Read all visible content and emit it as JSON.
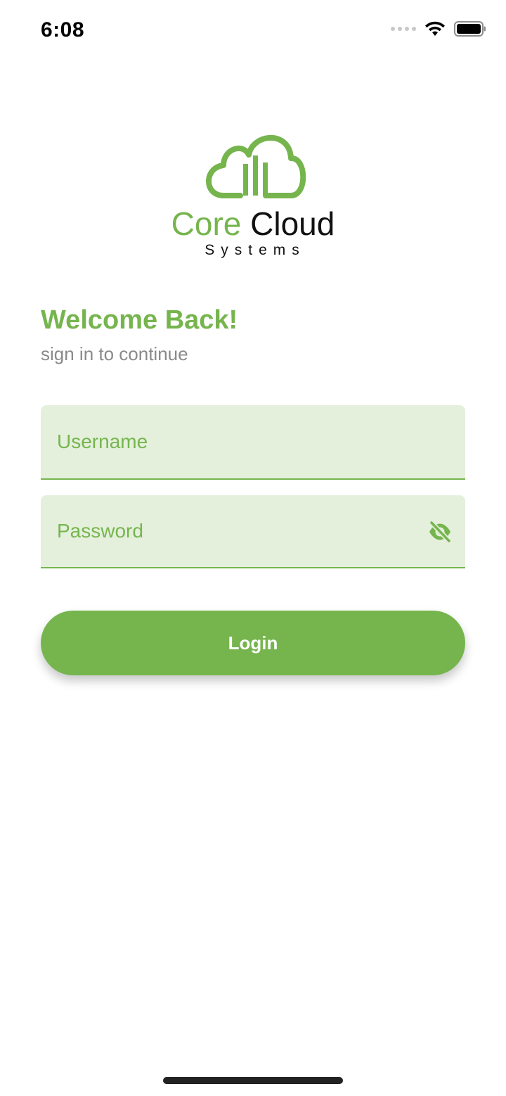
{
  "status_bar": {
    "time": "6:08",
    "icons": [
      "cellular-signal-icon",
      "wifi-icon",
      "battery-icon"
    ]
  },
  "logo": {
    "word1": "Core",
    "word2": "Cloud",
    "subtitle": "Systems",
    "icon": "cloud-buildings-icon"
  },
  "welcome": {
    "title": "Welcome Back!",
    "subtitle": "sign in to continue"
  },
  "form": {
    "username": {
      "value": "",
      "placeholder": "Username"
    },
    "password": {
      "value": "",
      "placeholder": "Password",
      "toggle_icon": "eye-off-icon"
    },
    "login_label": "Login"
  },
  "colors": {
    "accent": "#76b54e",
    "field_bg": "#e4f0dc",
    "muted_text": "#8a8a8a"
  }
}
